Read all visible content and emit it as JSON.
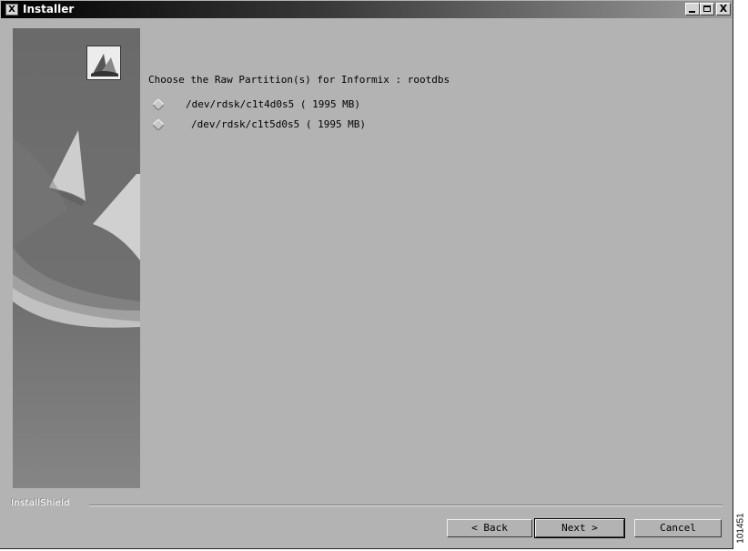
{
  "window": {
    "title": "Installer",
    "icon_letter": "X",
    "close_glyph": "X"
  },
  "prompt": "Choose the Raw Partition(s) for Informix : rootdbs",
  "options": [
    {
      "label": "/dev/rdsk/c1t4d0s5 ( 1995 MB)",
      "selected": false
    },
    {
      "label": "/dev/rdsk/c1t5d0s5 ( 1995 MB)",
      "selected": false
    }
  ],
  "footer": {
    "brand": "InstallShield"
  },
  "buttons": {
    "back": "< Back",
    "next": "Next >",
    "cancel": "Cancel"
  },
  "figure_id": "101451",
  "icons": {
    "title": "x-window-icon",
    "minimize": "minimize-icon",
    "maximize": "maximize-icon",
    "close": "close-icon",
    "logo": "installshield-logo-icon",
    "radio": "diamond-radio-icon"
  },
  "colors": {
    "window_bg": "#b3b3b3",
    "side_panel": "#6e6e6e",
    "titlebar_dark": "#000000"
  }
}
